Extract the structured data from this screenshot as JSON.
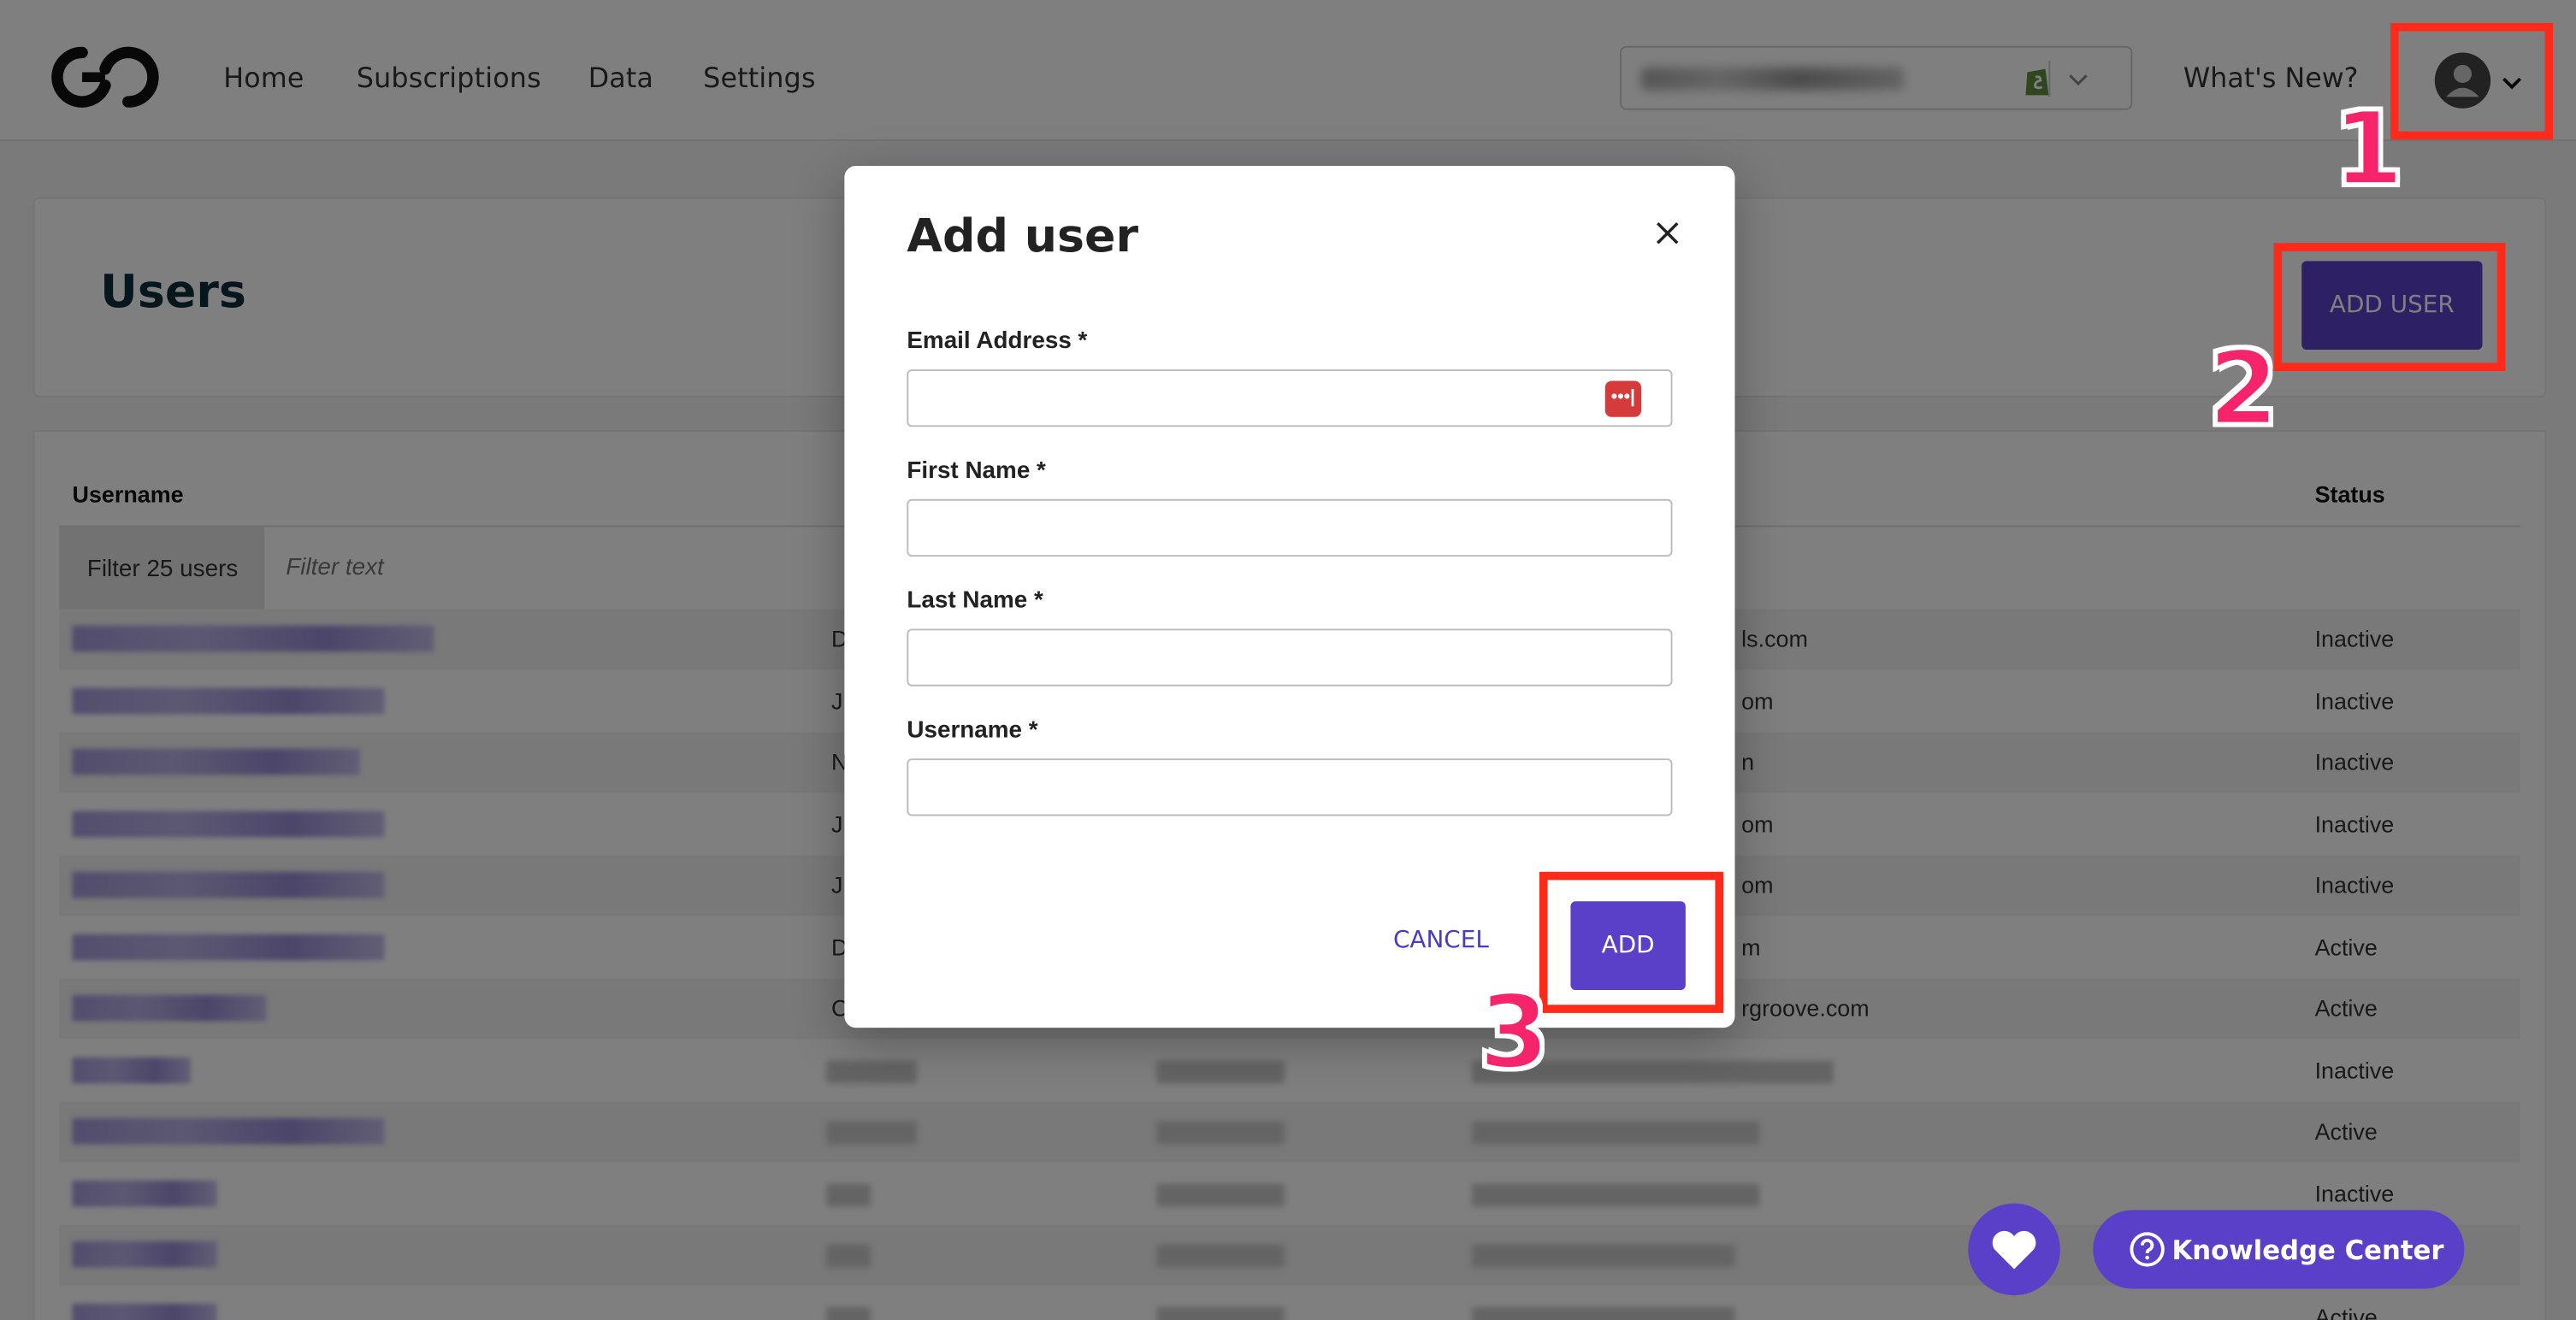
{
  "nav": {
    "items": [
      "Home",
      "Subscriptions",
      "Data",
      "Settings"
    ],
    "whats_new": "What's New?"
  },
  "users_page": {
    "title": "Users",
    "add_user_button": "ADD USER"
  },
  "table": {
    "columns": {
      "username": "Username",
      "status": "Status"
    },
    "filter_label": "Filter 25 users",
    "filter_placeholder": "Filter text",
    "rows": [
      {
        "first": "D",
        "email": "ls.com",
        "status": "Inactive"
      },
      {
        "first": "J",
        "email": "om",
        "status": "Inactive"
      },
      {
        "first": "N",
        "email": "n",
        "status": "Inactive"
      },
      {
        "first": "J",
        "email": "om",
        "status": "Inactive"
      },
      {
        "first": "J",
        "email": "om",
        "status": "Inactive"
      },
      {
        "first": "D",
        "email": "m",
        "status": "Active"
      },
      {
        "first": "C",
        "email": "rgroove.com",
        "status": "Active"
      },
      {
        "first": "",
        "email": "",
        "status": "Inactive"
      },
      {
        "first": "",
        "email": "",
        "status": "Active"
      },
      {
        "first": "",
        "email": "",
        "status": "Inactive"
      },
      {
        "first": "",
        "email": "",
        "status": ""
      },
      {
        "first": "",
        "email": "",
        "status": "Active"
      }
    ]
  },
  "modal": {
    "title": "Add user",
    "fields": [
      {
        "label": "Email Address *",
        "value": ""
      },
      {
        "label": "First Name *",
        "value": ""
      },
      {
        "label": "Last Name *",
        "value": ""
      },
      {
        "label": "Username *",
        "value": ""
      }
    ],
    "password_manager_icon": "•••|",
    "cancel": "CANCEL",
    "add": "ADD"
  },
  "annotations": [
    "1",
    "2",
    "3"
  ],
  "floating": {
    "knowledge_center": "Knowledge Center"
  },
  "colors": {
    "brand": "#5a40c8",
    "annotation_box": "#ff2a1a",
    "annotation_number": "#f5246b",
    "title": "#0b2f3a"
  },
  "icons": [
    "logo-icon",
    "shopify-icon",
    "chevron-down-icon",
    "user-avatar-icon",
    "close-icon",
    "password-manager-icon",
    "heart-icon",
    "help-circle-icon"
  ]
}
